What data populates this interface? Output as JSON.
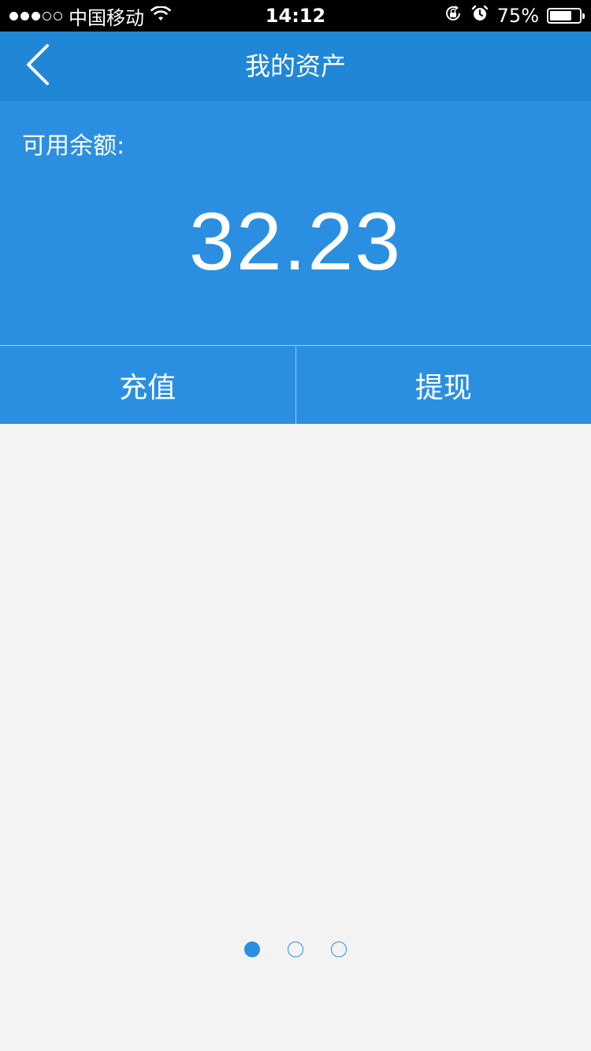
{
  "status_bar": {
    "carrier": "中国移动",
    "time": "14:12",
    "battery_percent": "75%",
    "battery_level": 0.75,
    "signal_bars_filled": 3,
    "signal_bars_total": 5
  },
  "nav": {
    "title": "我的资产",
    "back_icon": "chevron-left-icon"
  },
  "balance": {
    "label": "可用余额:",
    "amount": "32.23"
  },
  "actions": {
    "recharge_label": "充值",
    "withdraw_label": "提现"
  },
  "pager": {
    "total_pages": 3,
    "active_index": 0
  },
  "colors": {
    "nav_blue": "#1f87d6",
    "panel_blue": "#2a8fe0",
    "background": "#f4f3f4"
  }
}
